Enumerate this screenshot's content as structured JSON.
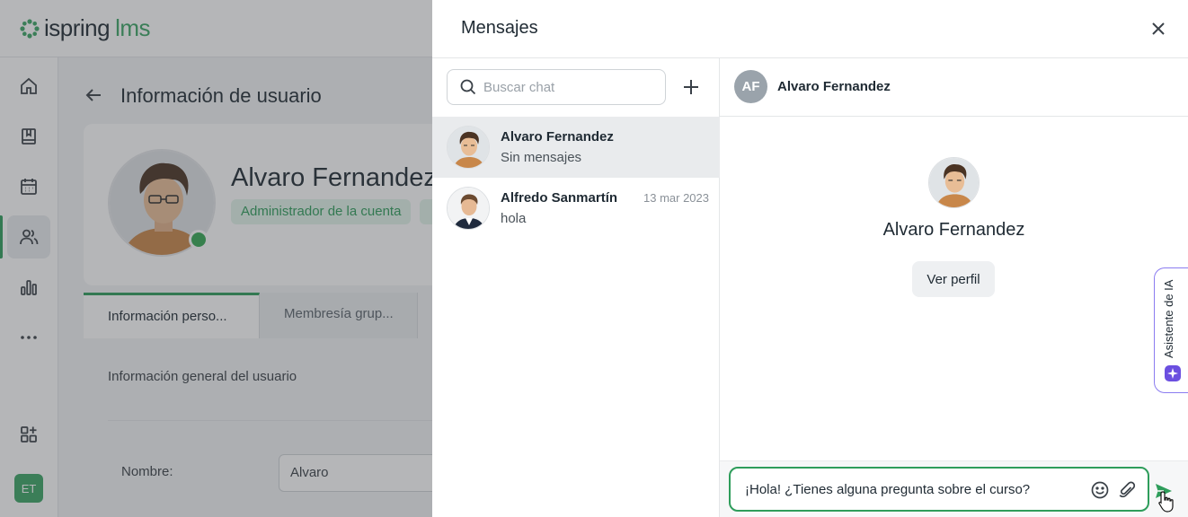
{
  "app": {
    "logo_name": "ispring",
    "logo_suffix": "lms",
    "user_initials": "ET",
    "brand_color": "#2e9d5b"
  },
  "sidebar": {
    "items": [
      {
        "icon": "home-icon"
      },
      {
        "icon": "book-icon"
      },
      {
        "icon": "calendar-icon"
      },
      {
        "icon": "users-icon",
        "active": true
      },
      {
        "icon": "bar-chart-icon"
      },
      {
        "icon": "more-icon"
      },
      {
        "icon": "add-widget-icon"
      }
    ]
  },
  "user_page": {
    "title": "Información de usuario",
    "name": "Alvaro Fernandez",
    "role": "Administrador de la cuenta",
    "tabs": [
      "Información perso...",
      "Membresía grup..."
    ],
    "section_title": "Información general del usuario",
    "fields": [
      {
        "label": "Nombre:",
        "value": "Alvaro"
      }
    ]
  },
  "messages": {
    "title": "Mensajes",
    "search_placeholder": "Buscar chat",
    "chats": [
      {
        "name": "Alvaro Fernandez",
        "preview": "Sin mensajes",
        "date": "",
        "selected": true
      },
      {
        "name": "Alfredo Sanmartín",
        "preview": "hola",
        "date": "13 mar 2023",
        "selected": false
      }
    ],
    "conversation": {
      "initials": "AF",
      "name": "Alvaro Fernandez",
      "view_profile": "Ver perfil",
      "composer_value": "¡Hola! ¿Tienes alguna pregunta sobre el curso?"
    },
    "ai_assistant_label": "Asistente de IA"
  }
}
